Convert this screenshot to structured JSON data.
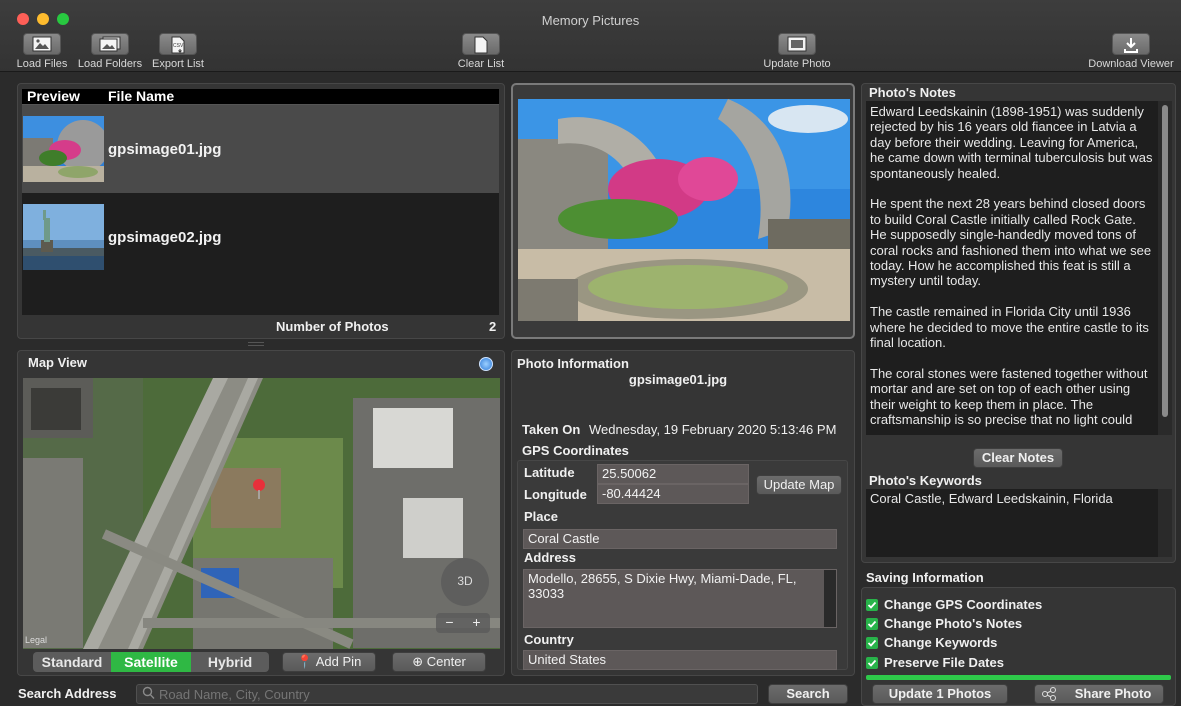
{
  "window": {
    "title": "Memory Pictures"
  },
  "toolbar": {
    "load_files": "Load Files",
    "load_folders": "Load Folders",
    "export_list": "Export List",
    "clear_list": "Clear List",
    "update_photo": "Update Photo",
    "download_viewer": "Download Viewer",
    "export_icon_text": "CSV"
  },
  "file_list": {
    "columns": [
      "Preview",
      "File Name"
    ],
    "rows": [
      {
        "file_name": "gpsimage01.jpg",
        "selected": true
      },
      {
        "file_name": "gpsimage02.jpg",
        "selected": false
      }
    ],
    "count_label": "Number of Photos",
    "count_value": "2"
  },
  "map": {
    "title": "Map View",
    "legal": "Legal",
    "compass_label": "3D",
    "zoom_out": "−",
    "zoom_in": "+",
    "modes": [
      "Standard",
      "Satellite",
      "Hybrid"
    ],
    "selected_mode": "Satellite",
    "add_pin": "Add Pin",
    "center": "Center"
  },
  "photo_info": {
    "title": "Photo Information",
    "file_name": "gpsimage01.jpg",
    "taken_on_label": "Taken On",
    "taken_on_value": "Wednesday, 19 February 2020 5:13:46 PM",
    "gps_label": "GPS Coordinates",
    "latitude_label": "Latitude",
    "latitude_value": "25.50062",
    "longitude_label": "Longitude",
    "longitude_value": "-80.44424",
    "update_map": "Update Map",
    "place_label": "Place",
    "place_value": "Coral Castle",
    "address_label": "Address",
    "address_value": "Modello, 28655, S Dixie Hwy, Miami-Dade, FL, 33033",
    "country_label": "Country",
    "country_value": "United States"
  },
  "notes": {
    "title": "Photo's Notes",
    "text": "Edward Leedskainin (1898-1951) was suddenly rejected by his 16 years old fiancee in Latvia a day before their wedding. Leaving for America, he came down with terminal tuberculosis but was spontaneously healed.\n\nHe spent the next 28 years behind closed doors to build Coral Castle initially called Rock Gate. He supposedly single-handedly moved tons of coral rocks and fashioned them into what we see today. How he accomplished this feat is still a mystery until today.\n\nThe castle remained in Florida City until 1936 where he decided to move the entire castle to its final location.\n\nThe coral stones were fastened together without mortar and are set on top of each other using their weight to keep them in place. The craftsmanship is so precise that no light could",
    "clear": "Clear Notes"
  },
  "keywords": {
    "title": "Photo's Keywords",
    "text": "Coral Castle, Edward Leedskainin, Florida"
  },
  "saving": {
    "title": "Saving Information",
    "options": [
      {
        "label": "Change GPS Coordinates",
        "checked": true
      },
      {
        "label": "Change Photo's Notes",
        "checked": true
      },
      {
        "label": "Change Keywords",
        "checked": true
      },
      {
        "label": "Preserve File Dates",
        "checked": true
      }
    ],
    "progress": 1.0,
    "update_button": "Update 1 Photos",
    "share_button": "Share Photo"
  },
  "search": {
    "label": "Search Address",
    "placeholder": "Road Name, City, Country",
    "button": "Search"
  },
  "colors": {
    "accent_green": "#28b34a",
    "pin_red": "#e8303a",
    "progress_green": "#2ec94a"
  }
}
